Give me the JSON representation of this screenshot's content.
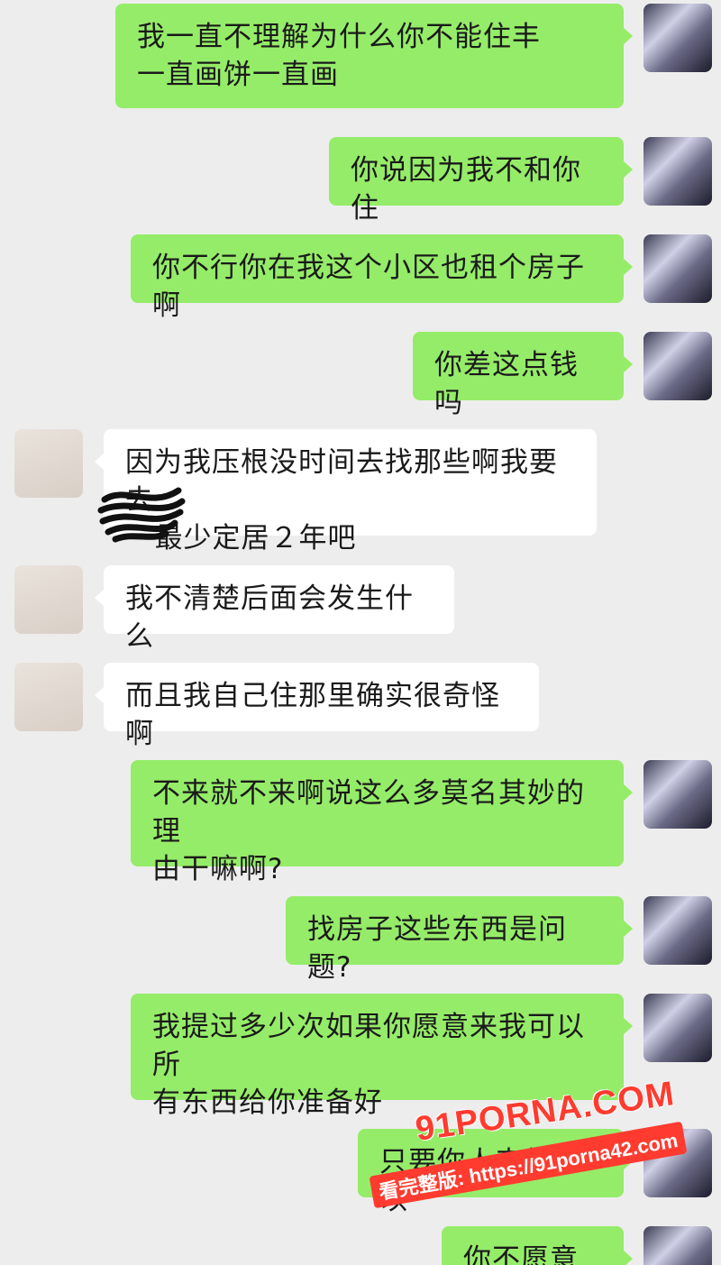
{
  "conversation": {
    "messages": [
      {
        "side": "right",
        "text": "我一直不理解为什么你不能住丰\n一直画饼一直画"
      },
      {
        "side": "right",
        "text": "你说因为我不和你住"
      },
      {
        "side": "right",
        "text": "你不行你在我这个小区也租个房子啊"
      },
      {
        "side": "right",
        "text": "你差这点钱吗"
      },
      {
        "side": "left",
        "text": "因为我压根没时间去找那些啊我要去\n   最少定居２年吧"
      },
      {
        "side": "left",
        "text": "我不清楚后面会发生什么"
      },
      {
        "side": "left",
        "text": "而且我自己住那里确实很奇怪啊"
      },
      {
        "side": "right",
        "text": "不来就不来啊说这么多莫名其妙的理\n由干嘛啊?"
      },
      {
        "side": "right",
        "text": "找房子这些东西是问题?"
      },
      {
        "side": "right",
        "text": "我提过多少次如果你愿意来我可以所\n有东西给你准备好"
      },
      {
        "side": "right",
        "text": "只要你人来就可以"
      },
      {
        "side": "right",
        "text": "你不愿意啊"
      }
    ]
  },
  "avatars": {
    "me": "anime-character-avatar",
    "other": "pig-plush-avatar"
  },
  "watermark": {
    "logo": "91PORNA.COM",
    "url": "看完整版: https://91porna42.com"
  },
  "colors": {
    "background": "#ededed",
    "my_bubble": "#95ec69",
    "their_bubble": "#ffffff",
    "watermark_red": "#ff3b2f"
  }
}
